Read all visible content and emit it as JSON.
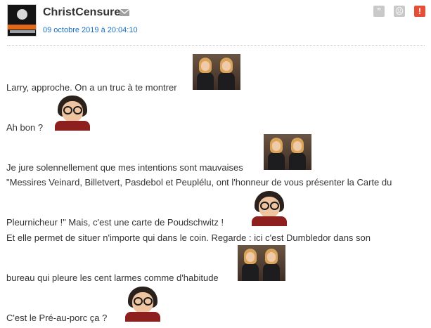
{
  "post": {
    "author": "ChristCensure",
    "date": "09 octobre 2019 à 20:04:10",
    "icons": {
      "mail": "envelope-icon",
      "quote": "quote-icon",
      "smiley": "smiley-icon",
      "report": "alert-icon"
    },
    "quote_glyph": "”",
    "smiley_glyph": "☹",
    "report_glyph": "!",
    "colors": {
      "username": "#333333",
      "date": "#1b70c1",
      "button_grey": "#c9c9c9",
      "report_red": "#e54f37"
    },
    "lines": [
      "Larry, approche. On a un truc à te montrer",
      "Ah bon ?",
      "Je jure solennellement que mes intentions sont mauvaises",
      "\"Messires Veinard, Billetvert, Pasdebol et Peuplélu, ont l'honneur de vous présenter la Carte du",
      "Pleurnicheur !\" Mais, c'est une carte de Poudschwitz !",
      "Et elle permet de situer n'importe qui dans le coin. Regarde : ici c'est Dumbledor dans son",
      "bureau qui pleure les cent larmes comme d'habitude",
      "C'est le Pré-au-porc ça ?"
    ]
  }
}
